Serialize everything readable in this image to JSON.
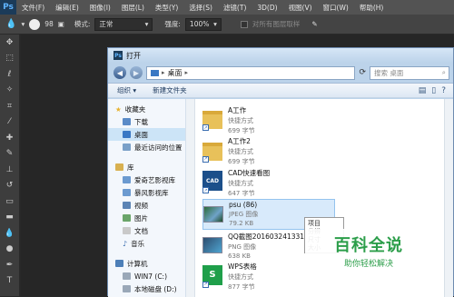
{
  "app": {
    "logo": "Ps"
  },
  "menubar": {
    "items": [
      "文件(F)",
      "编辑(E)",
      "图像(I)",
      "图层(L)",
      "类型(Y)",
      "选择(S)",
      "滤镜(T)",
      "3D(D)",
      "视图(V)",
      "窗口(W)",
      "帮助(H)"
    ]
  },
  "options": {
    "brush_size": "98",
    "mode_label": "模式:",
    "mode_value": "正常",
    "opacity_label": "强度:",
    "opacity_value": "100%",
    "sample_all_label": "对所有图层取样"
  },
  "dialog": {
    "title": "打开",
    "address": "桌面",
    "search_placeholder": "搜索 桌面",
    "organize": "组织 ▾",
    "new_folder": "新建文件夹"
  },
  "nav": {
    "favorites": "收藏夹",
    "downloads": "下载",
    "desktop": "桌面",
    "recent": "最近访问的位置",
    "libraries": "库",
    "iqiyi": "爱奇艺影视库",
    "baofeng": "暴风影视库",
    "videos": "视频",
    "pictures": "图片",
    "documents": "文档",
    "music": "音乐",
    "computer": "计算机",
    "drive_c": "WIN7 (C:)",
    "drive_d": "本地磁盘 (D:)"
  },
  "files": [
    {
      "name": "A工作",
      "type": "快捷方式",
      "size": "699 字节"
    },
    {
      "name": "A工作2",
      "type": "快捷方式",
      "size": "699 字节"
    },
    {
      "name": "CAD快速看图",
      "type": "快捷方式",
      "size": "647 字节"
    },
    {
      "name": "psu (86)",
      "type": "JPEG 图像",
      "size": "79.2 KB"
    },
    {
      "name": "QQ截图2016032413310",
      "type": "PNG 图像",
      "size": "638 KB"
    },
    {
      "name": "WPS表格",
      "type": "快捷方式",
      "size": "877 字节"
    }
  ],
  "tooltip": {
    "lines": [
      "项目",
      "分辨",
      "尺寸",
      "大小"
    ]
  },
  "watermark": {
    "title": "百科全说",
    "subtitle": "助你轻松解决"
  }
}
